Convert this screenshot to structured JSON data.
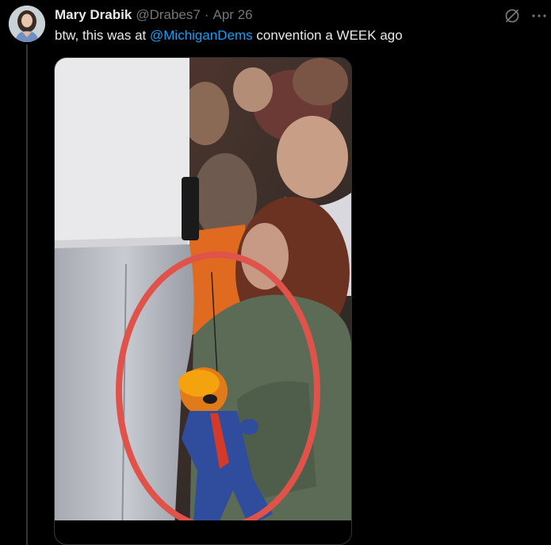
{
  "tweet": {
    "display_name": "Mary Drabik",
    "handle": "@Drabes7",
    "separator": "·",
    "date": "Apr 26",
    "text_before": "btw, this was at ",
    "mention": "@MichiganDems",
    "text_after": " convention a WEEK ago"
  },
  "icons": {
    "grok": "slash-circle-icon",
    "more": "more-icon"
  },
  "colors": {
    "background": "#000000",
    "text": "#e7e9ea",
    "muted": "#71767b",
    "link": "#1d9bf0",
    "circle_annotation": "#e0534a"
  }
}
